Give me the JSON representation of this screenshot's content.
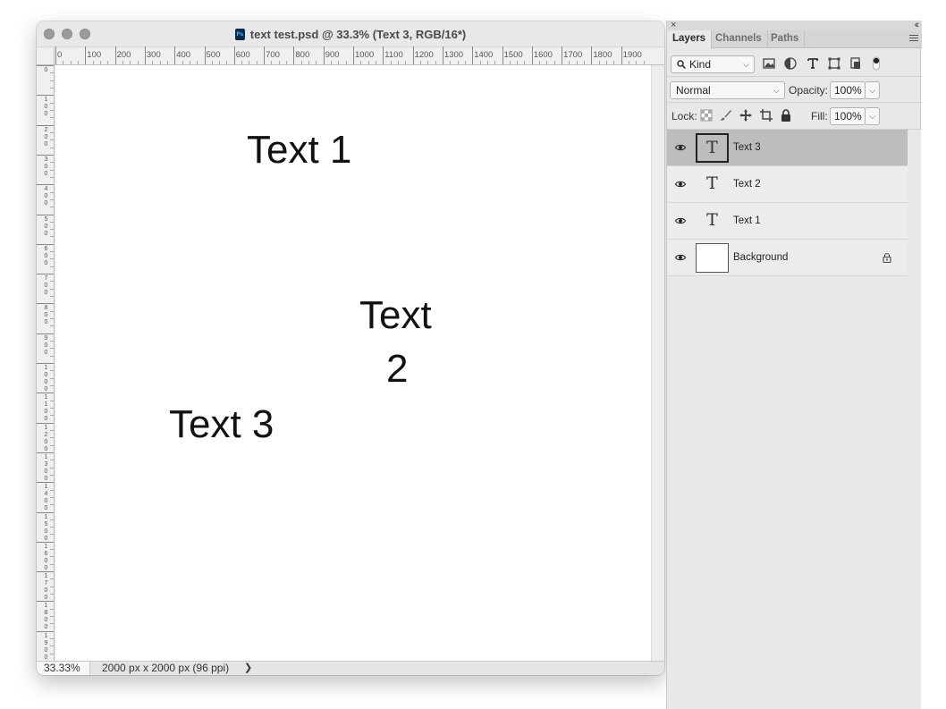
{
  "document": {
    "title": "text test.psd @ 33.3% (Text 3, RGB/16*)",
    "app_icon_label": "Ps",
    "ruler_h_labels": [
      "0",
      "100",
      "200",
      "300",
      "400",
      "500",
      "600",
      "700",
      "800",
      "900",
      "1000",
      "1100",
      "1200",
      "1300",
      "1400",
      "1500",
      "1600",
      "1700",
      "1800",
      "1900"
    ],
    "ruler_v_labels": [
      "0",
      "100",
      "200",
      "300",
      "400",
      "500",
      "600",
      "700",
      "800",
      "900",
      "1000",
      "1100",
      "1200",
      "1300",
      "1400",
      "1500",
      "1600",
      "1700",
      "1800",
      "1900"
    ],
    "canvas_texts": [
      "Text 1",
      "Text",
      "2",
      "Text 3"
    ],
    "status": {
      "zoom": "33.33%",
      "doc_size": "2000 px x 2000 px (96 ppi)",
      "arrow": "❯"
    }
  },
  "panel": {
    "close_glyph": "×",
    "collapse_glyph": "‹‹",
    "tabs": [
      "Layers",
      "Channels",
      "Paths"
    ],
    "active_tab": "Layers",
    "filter": {
      "kind_label": "Kind",
      "icons": [
        "image-filter-icon",
        "adjustment-filter-icon",
        "type-filter-icon",
        "shape-filter-icon",
        "smart-object-filter-icon",
        "filter-toggle-icon"
      ]
    },
    "blend_mode": "Normal",
    "opacity_label": "Opacity:",
    "opacity_value": "100%",
    "lock_label": "Lock:",
    "fill_label": "Fill:",
    "fill_value": "100%",
    "layers": [
      {
        "name": "Text 3",
        "type": "text",
        "thumb": "T",
        "selected": true,
        "locked": false
      },
      {
        "name": "Text 2",
        "type": "text",
        "thumb": "T",
        "selected": false,
        "locked": false
      },
      {
        "name": "Text 1",
        "type": "text",
        "thumb": "T",
        "selected": false,
        "locked": false
      },
      {
        "name": "Background",
        "type": "raster",
        "thumb": "",
        "selected": false,
        "locked": true
      }
    ]
  }
}
